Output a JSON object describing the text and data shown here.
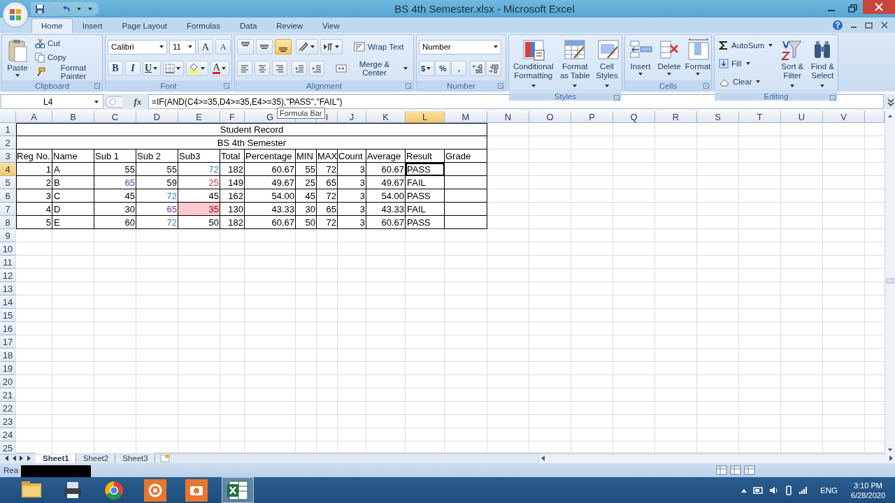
{
  "window": {
    "title": "BS 4th Semester.xlsx - Microsoft Excel"
  },
  "ribbon_tabs": [
    {
      "label": "Home",
      "selected": true
    },
    {
      "label": "Insert",
      "selected": false
    },
    {
      "label": "Page Layout",
      "selected": false
    },
    {
      "label": "Formulas",
      "selected": false
    },
    {
      "label": "Data",
      "selected": false
    },
    {
      "label": "Review",
      "selected": false
    },
    {
      "label": "View",
      "selected": false
    }
  ],
  "ribbon": {
    "clipboard": {
      "label": "Clipboard",
      "paste": "Paste",
      "cut": "Cut",
      "copy": "Copy",
      "format_painter": "Format Painter"
    },
    "font": {
      "label": "Font",
      "font_name": "Calibri",
      "font_size": "11",
      "grow": "A",
      "shrink": "A",
      "bold": "B",
      "italic": "I",
      "underline": "U",
      "font_color": "A"
    },
    "alignment": {
      "label": "Alignment",
      "vertical": [
        {
          "selected": false
        },
        {
          "selected": false
        },
        {
          "selected": true
        }
      ],
      "wrap_text": "Wrap Text",
      "merge_center": "Merge & Center"
    },
    "number": {
      "label": "Number",
      "format": "Number",
      "currency": "$",
      "percent": "%",
      "comma": ","
    },
    "styles": {
      "label": "Styles",
      "buttons": [
        "Conditional Formatting",
        "Format as Table",
        "Cell Styles"
      ]
    },
    "cells": {
      "label": "Cells",
      "buttons": [
        "Insert",
        "Delete",
        "Format"
      ]
    },
    "editing": {
      "label": "Editing",
      "autosum": "AutoSum",
      "fill": "Fill",
      "clear": "Clear",
      "buttons": [
        "Sort & Filter",
        "Find & Select"
      ]
    }
  },
  "formula_bar": {
    "name_box": "L4",
    "fx": "fx",
    "formula": "=IF(AND(C4>=35,D4>=35,E4>=35),\"PASS\",\"FAIL\")",
    "tooltip": "Formula Bar"
  },
  "sheet": {
    "columns": [
      {
        "label": "A",
        "selected": false
      },
      {
        "label": "B",
        "selected": false
      },
      {
        "label": "C",
        "selected": false
      },
      {
        "label": "D",
        "selected": false
      },
      {
        "label": "E",
        "selected": false
      },
      {
        "label": "F",
        "selected": false
      },
      {
        "label": "G",
        "selected": false
      },
      {
        "selected": false
      },
      {
        "label": "I",
        "selected": false
      },
      {
        "label": "J",
        "selected": false
      },
      {
        "label": "K",
        "selected": false
      },
      {
        "label": "L",
        "selected": true
      },
      {
        "label": "M",
        "selected": false
      },
      {
        "label": "N",
        "selected": false
      },
      {
        "label": "O",
        "selected": false
      },
      {
        "label": "P",
        "selected": false
      },
      {
        "label": "Q",
        "selected": false
      },
      {
        "label": "R",
        "selected": false
      },
      {
        "label": "S",
        "selected": false
      },
      {
        "label": "T",
        "selected": false
      },
      {
        "label": "U",
        "selected": false
      },
      {
        "label": "V",
        "selected": false
      }
    ],
    "row_headers": [
      {
        "label": "1",
        "selected": false
      },
      {
        "label": "2",
        "selected": false
      },
      {
        "label": "3",
        "selected": false
      },
      {
        "label": "4",
        "selected": true
      },
      {
        "label": "5",
        "selected": false
      },
      {
        "label": "6",
        "selected": false
      },
      {
        "label": "7",
        "selected": false
      },
      {
        "label": "8",
        "selected": false
      },
      {
        "label": "9",
        "selected": false
      },
      {
        "label": "10",
        "selected": false
      },
      {
        "label": "11",
        "selected": false
      },
      {
        "label": "12",
        "selected": false
      },
      {
        "label": "13",
        "selected": false
      },
      {
        "label": "14",
        "selected": false
      },
      {
        "label": "15",
        "selected": false
      },
      {
        "label": "16",
        "selected": false
      },
      {
        "label": "17",
        "selected": false
      },
      {
        "label": "18",
        "selected": false
      },
      {
        "label": "19",
        "selected": false
      },
      {
        "label": "20",
        "selected": false
      },
      {
        "label": "21",
        "selected": false
      },
      {
        "label": "22",
        "selected": false
      },
      {
        "label": "23",
        "selected": false
      },
      {
        "label": "24",
        "selected": false
      },
      {
        "label": "25",
        "selected": false
      }
    ],
    "rows": [
      {
        "kind": "title",
        "text": "Student Record"
      },
      {
        "kind": "title",
        "text": "BS 4th Semester"
      },
      {
        "kind": "header",
        "cells": [
          "Reg No.",
          "Name",
          "Sub 1",
          "Sub 2",
          "Sub3",
          "Total",
          "Percentage",
          "MIN",
          "MAX",
          "Count",
          "Average",
          "Result",
          "Grade"
        ]
      },
      {
        "kind": "record",
        "cells": [
          {
            "text": "1",
            "active": false
          },
          {
            "text": "A",
            "active": false
          },
          {
            "text": "55",
            "active": false
          },
          {
            "text": "55",
            "active": false
          },
          {
            "text": "72",
            "color": "#31859c",
            "active": false
          },
          {
            "text": "182",
            "active": false
          },
          {
            "text": "60.67",
            "active": false
          },
          {
            "text": "55",
            "active": false
          },
          {
            "text": "72",
            "active": false
          },
          {
            "text": "3",
            "active": false
          },
          {
            "text": "60.67",
            "active": false
          },
          {
            "text": "PASS",
            "active": true
          }
        ]
      },
      {
        "kind": "record",
        "cells": [
          {
            "text": "2",
            "active": false
          },
          {
            "text": "B",
            "active": false
          },
          {
            "text": "65",
            "color": "#7030a0",
            "active": false
          },
          {
            "text": "59",
            "active": false
          },
          {
            "text": "25",
            "color": "#c0392b",
            "active": false
          },
          {
            "text": "149",
            "active": false
          },
          {
            "text": "49.67",
            "active": false
          },
          {
            "text": "25",
            "active": false
          },
          {
            "text": "65",
            "active": false
          },
          {
            "text": "3",
            "active": false
          },
          {
            "text": "49.67",
            "active": false
          },
          {
            "text": "FAIL",
            "active": false
          }
        ]
      },
      {
        "kind": "record",
        "cells": [
          {
            "text": "3",
            "active": false
          },
          {
            "text": "C",
            "active": false
          },
          {
            "text": "45",
            "active": false
          },
          {
            "text": "72",
            "color": "#31859c",
            "active": false
          },
          {
            "text": "45",
            "active": false
          },
          {
            "text": "162",
            "active": false
          },
          {
            "text": "54.00",
            "active": false
          },
          {
            "text": "45",
            "active": false
          },
          {
            "text": "72",
            "active": false
          },
          {
            "text": "3",
            "active": false
          },
          {
            "text": "54.00",
            "active": false
          },
          {
            "text": "PASS",
            "active": false
          }
        ]
      },
      {
        "kind": "record",
        "cells": [
          {
            "text": "4",
            "active": false
          },
          {
            "text": "D",
            "active": false
          },
          {
            "text": "30",
            "active": false
          },
          {
            "text": "65",
            "color": "#7030a0",
            "active": false
          },
          {
            "text": "35",
            "color": "#9c0006",
            "highlight": true,
            "active": false
          },
          {
            "text": "130",
            "active": false
          },
          {
            "text": "43.33",
            "active": false
          },
          {
            "text": "30",
            "active": false
          },
          {
            "text": "65",
            "active": false
          },
          {
            "text": "3",
            "active": false
          },
          {
            "text": "43.33",
            "active": false
          },
          {
            "text": "FAIL",
            "active": false
          }
        ]
      },
      {
        "kind": "record",
        "cells": [
          {
            "text": "5",
            "active": false
          },
          {
            "text": "E",
            "active": false
          },
          {
            "text": "60",
            "active": false
          },
          {
            "text": "72",
            "color": "#31859c",
            "active": false
          },
          {
            "text": "50",
            "active": false
          },
          {
            "text": "182",
            "active": false
          },
          {
            "text": "60.67",
            "active": false
          },
          {
            "text": "50",
            "active": false
          },
          {
            "text": "72",
            "active": false
          },
          {
            "text": "3",
            "active": false
          },
          {
            "text": "60.67",
            "active": false
          },
          {
            "text": "PASS",
            "active": false
          }
        ]
      }
    ]
  },
  "sheet_tabs": [
    {
      "label": "Sheet1",
      "selected": true
    },
    {
      "label": "Sheet2",
      "selected": false
    },
    {
      "label": "Sheet3",
      "selected": false
    }
  ],
  "status_bar": {
    "text": "Rea"
  },
  "taskbar": {
    "apps": [
      {
        "kind": "folder",
        "selected": false
      },
      {
        "kind": "printer",
        "selected": false
      },
      {
        "kind": "browser",
        "selected": false
      },
      {
        "kind": "recorder",
        "selected": false
      },
      {
        "kind": "camera",
        "selected": false
      },
      {
        "kind": "spreadsheet",
        "selected": true
      }
    ],
    "language": "ENG",
    "time": "3:10 PM",
    "date": "6/28/2020"
  }
}
